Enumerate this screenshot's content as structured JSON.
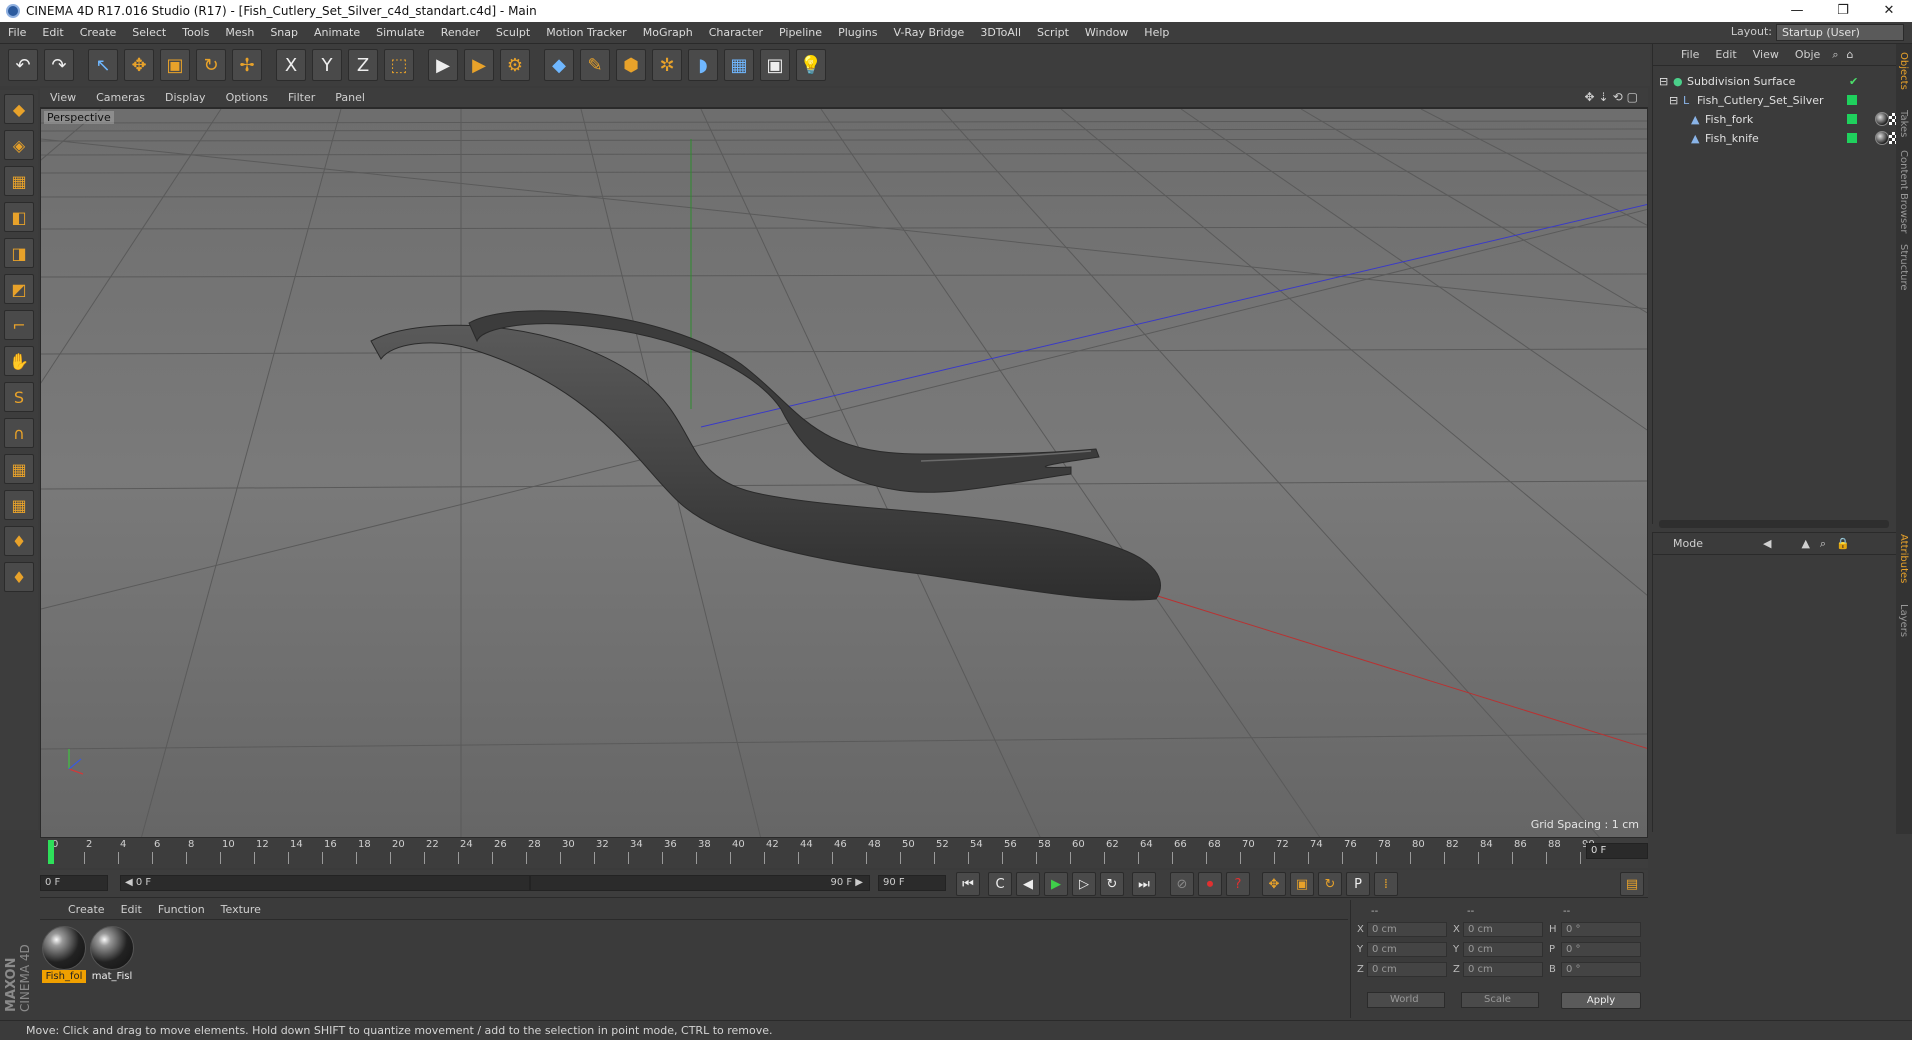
{
  "window": {
    "title": "CINEMA 4D R17.016 Studio (R17) - [Fish_Cutlery_Set_Silver_c4d_standart.c4d] - Main",
    "min": "—",
    "restore": "❐",
    "close": "✕"
  },
  "menu": [
    "File",
    "Edit",
    "Create",
    "Select",
    "Tools",
    "Mesh",
    "Snap",
    "Animate",
    "Simulate",
    "Render",
    "Sculpt",
    "Motion Tracker",
    "MoGraph",
    "Character",
    "Pipeline",
    "Plugins",
    "V-Ray Bridge",
    "3DToAll",
    "Script",
    "Window",
    "Help"
  ],
  "layout": {
    "label": "Layout:",
    "value": "Startup (User)"
  },
  "toolbar": {
    "undo": "↶",
    "redo": "↷",
    "select": "↖",
    "move": "✥",
    "scale": "▣",
    "rotate": "↻",
    "transform": "✢",
    "x": "X",
    "y": "Y",
    "z": "Z",
    "coord": "⬚",
    "render_view": "▶",
    "render_pic": "▶",
    "render_settings": "⚙",
    "cube": "◆",
    "pen": "✎",
    "nurbs": "⬢",
    "array": "✲",
    "deformer": "◗",
    "floor": "▦",
    "camera": "▣",
    "light": "💡"
  },
  "lefttools": [
    "◆",
    "◈",
    "▦",
    "◧",
    "◨",
    "◩",
    "⌐",
    "✋",
    "S",
    "∩",
    "▦",
    "▦",
    "♦",
    "♦"
  ],
  "viewport": {
    "menu": [
      "View",
      "Cameras",
      "Display",
      "Options",
      "Filter",
      "Panel"
    ],
    "icons": "✥⇣⟲▢",
    "label": "Perspective",
    "grid_spacing": "Grid Spacing : 1 cm"
  },
  "objects": {
    "menu": [
      "File",
      "Edit",
      "View",
      "Obje"
    ],
    "items": [
      {
        "name": "Subdivision Surface",
        "indent": 0
      },
      {
        "name": "Fish_Cutlery_Set_Silver",
        "indent": 1
      },
      {
        "name": "Fish_fork",
        "indent": 2
      },
      {
        "name": "Fish_knife",
        "indent": 2
      }
    ]
  },
  "attributes": {
    "mode": "Mode"
  },
  "right_tabs": [
    "Objects",
    "Takes",
    "Content Browser",
    "Structure",
    "Attributes",
    "Layers"
  ],
  "timeline": {
    "ticks": [
      "0",
      "2",
      "4",
      "6",
      "8",
      "10",
      "12",
      "14",
      "16",
      "18",
      "20",
      "22",
      "24",
      "26",
      "28",
      "30",
      "32",
      "34",
      "36",
      "38",
      "40",
      "42",
      "44",
      "46",
      "48",
      "50",
      "52",
      "54",
      "56",
      "58",
      "60",
      "62",
      "64",
      "66",
      "68",
      "70",
      "72",
      "74",
      "76",
      "78",
      "80",
      "82",
      "84",
      "86",
      "88",
      "90"
    ],
    "current": "0 F"
  },
  "transport": {
    "start": "0 F",
    "range_start": "◀ 0 F",
    "range_end": "90 F ▶",
    "end": "90 F",
    "buttons": [
      "⏮",
      "C",
      "◀",
      "▶",
      "▷",
      "↻",
      "⏭"
    ]
  },
  "materials": {
    "menu": [
      "Create",
      "Edit",
      "Function",
      "Texture"
    ],
    "items": [
      {
        "label": "Fish_fol",
        "selected": true
      },
      {
        "label": "mat_Fisl",
        "selected": false
      }
    ]
  },
  "coords": {
    "headers": [
      "--",
      "--",
      "--"
    ],
    "rows": [
      {
        "a": "X",
        "av": "0 cm",
        "b": "X",
        "bv": "0 cm",
        "c": "H",
        "cv": "0 °"
      },
      {
        "a": "Y",
        "av": "0 cm",
        "b": "Y",
        "bv": "0 cm",
        "c": "P",
        "cv": "0 °"
      },
      {
        "a": "Z",
        "av": "0 cm",
        "b": "Z",
        "bv": "0 cm",
        "c": "B",
        "cv": "0 °"
      }
    ],
    "world": "World",
    "scale": "Scale",
    "apply": "Apply"
  },
  "brand": {
    "maxon": "MAXON",
    "c4d": "CINEMA 4D"
  },
  "status": "Move: Click and drag to move elements. Hold down SHIFT to quantize movement / add to the selection in point mode, CTRL to remove."
}
